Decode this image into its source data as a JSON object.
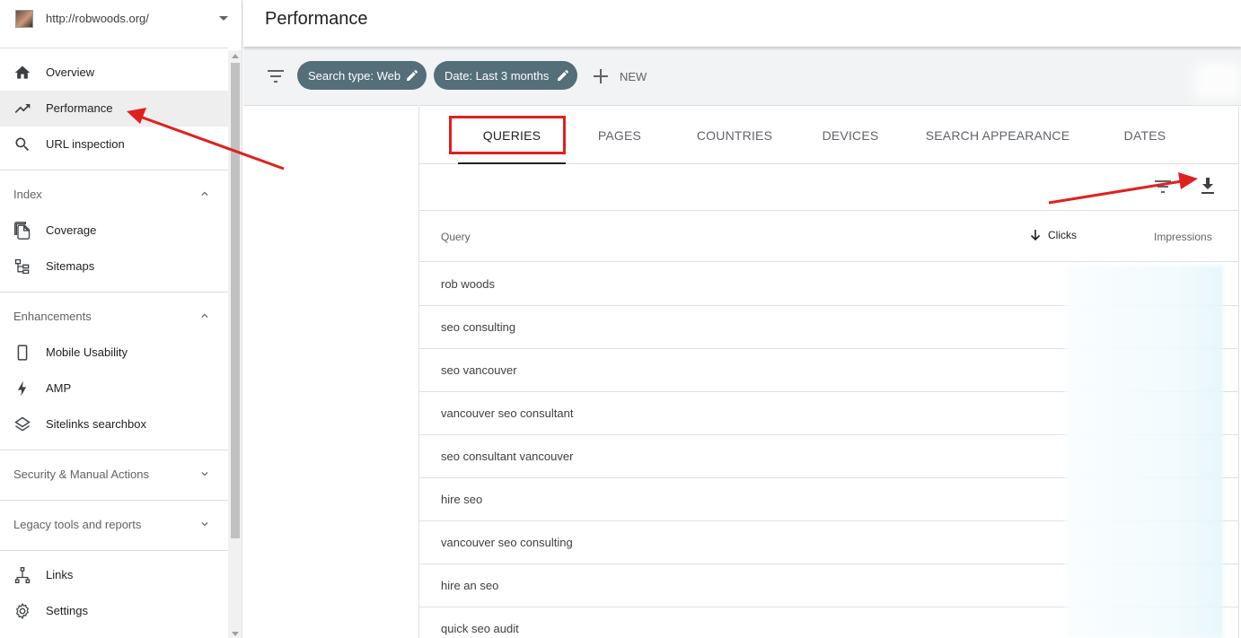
{
  "property": {
    "url": "http://robwoods.org/"
  },
  "sidebar": {
    "top_items": [
      {
        "label": "Overview",
        "icon": "home-icon"
      },
      {
        "label": "Performance",
        "icon": "trending-up-icon"
      },
      {
        "label": "URL inspection",
        "icon": "search-icon"
      }
    ],
    "index": {
      "title": "Index",
      "items": [
        {
          "label": "Coverage"
        },
        {
          "label": "Sitemaps"
        }
      ]
    },
    "enhancements": {
      "title": "Enhancements",
      "items": [
        {
          "label": "Mobile Usability"
        },
        {
          "label": "AMP"
        },
        {
          "label": "Sitelinks searchbox"
        }
      ]
    },
    "security": {
      "title": "Security & Manual Actions"
    },
    "legacy": {
      "title": "Legacy tools and reports"
    },
    "bottom_items": [
      {
        "label": "Links"
      },
      {
        "label": "Settings"
      }
    ]
  },
  "header": {
    "title": "Performance"
  },
  "filters": {
    "chips": [
      {
        "label": "Search type: Web"
      },
      {
        "label": "Date: Last 3 months"
      }
    ],
    "new_label": "NEW"
  },
  "tabs": [
    {
      "label": "QUERIES"
    },
    {
      "label": "PAGES"
    },
    {
      "label": "COUNTRIES"
    },
    {
      "label": "DEVICES"
    },
    {
      "label": "SEARCH APPEARANCE"
    },
    {
      "label": "DATES"
    }
  ],
  "table": {
    "columns": {
      "query": "Query",
      "clicks": "Clicks",
      "impressions": "Impressions"
    },
    "rows": [
      "rob woods",
      "seo consulting",
      "seo vancouver",
      "vancouver seo consultant",
      "seo consultant vancouver",
      "hire seo",
      "vancouver seo consulting",
      "hire an seo",
      "quick seo audit"
    ]
  },
  "colors": {
    "chip": "#546e7a",
    "annotation": "#e0201d",
    "active_nav": "#eeeeee"
  }
}
